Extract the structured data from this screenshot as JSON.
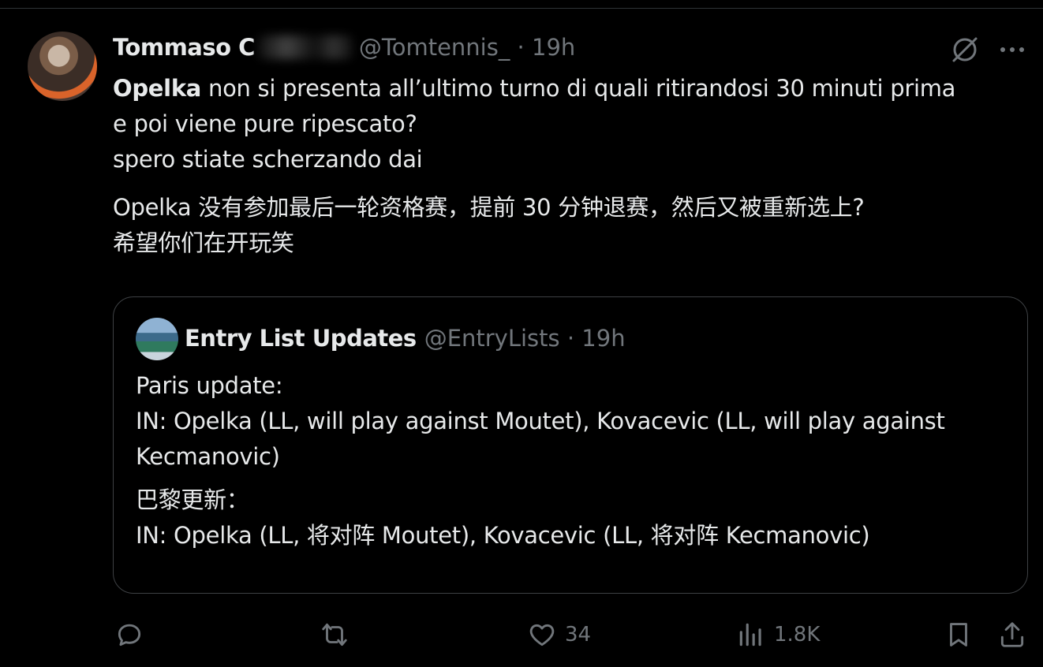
{
  "tweet": {
    "display_name": "Tommaso C",
    "handle_time": "@Tomtennis_ · 19h",
    "text_bold": "Opelka",
    "text_line1_rest": " non si presenta all’ultimo turno di quali ritirandosi 30 minuti prima",
    "text_line2": "e poi viene pure ripescato?",
    "text_line3": "spero stiate scherzando dai",
    "translation_line1": "Opelka 没有参加最后一轮资格赛，提前 30 分钟退赛，然后又被重新选上?",
    "translation_line2": "希望你们在开玩笑"
  },
  "quote": {
    "display_name": "Entry List Updates",
    "handle_time": "@EntryLists · 19h",
    "line1": "Paris update:",
    "line2": "IN: Opelka (LL, will play against Moutet), Kovacevic (LL, will play against",
    "line3": "Kecmanovic)",
    "translation_line1": "巴黎更新：",
    "translation_line2": "IN: Opelka (LL, 将对阵 Moutet), Kovacevic (LL, 将对阵 Kecmanovic)"
  },
  "actions": {
    "reply_icon": "reply-icon",
    "retweet_icon": "retweet-icon",
    "like_icon": "heart-icon",
    "like_count": "34",
    "views_icon": "views-icon",
    "views_count": "1.8K",
    "bookmark_icon": "bookmark-icon",
    "share_icon": "share-icon"
  },
  "colors": {
    "background": "#000000",
    "text": "#e7e9ea",
    "secondary": "#71767b",
    "border": "#3e4144"
  }
}
